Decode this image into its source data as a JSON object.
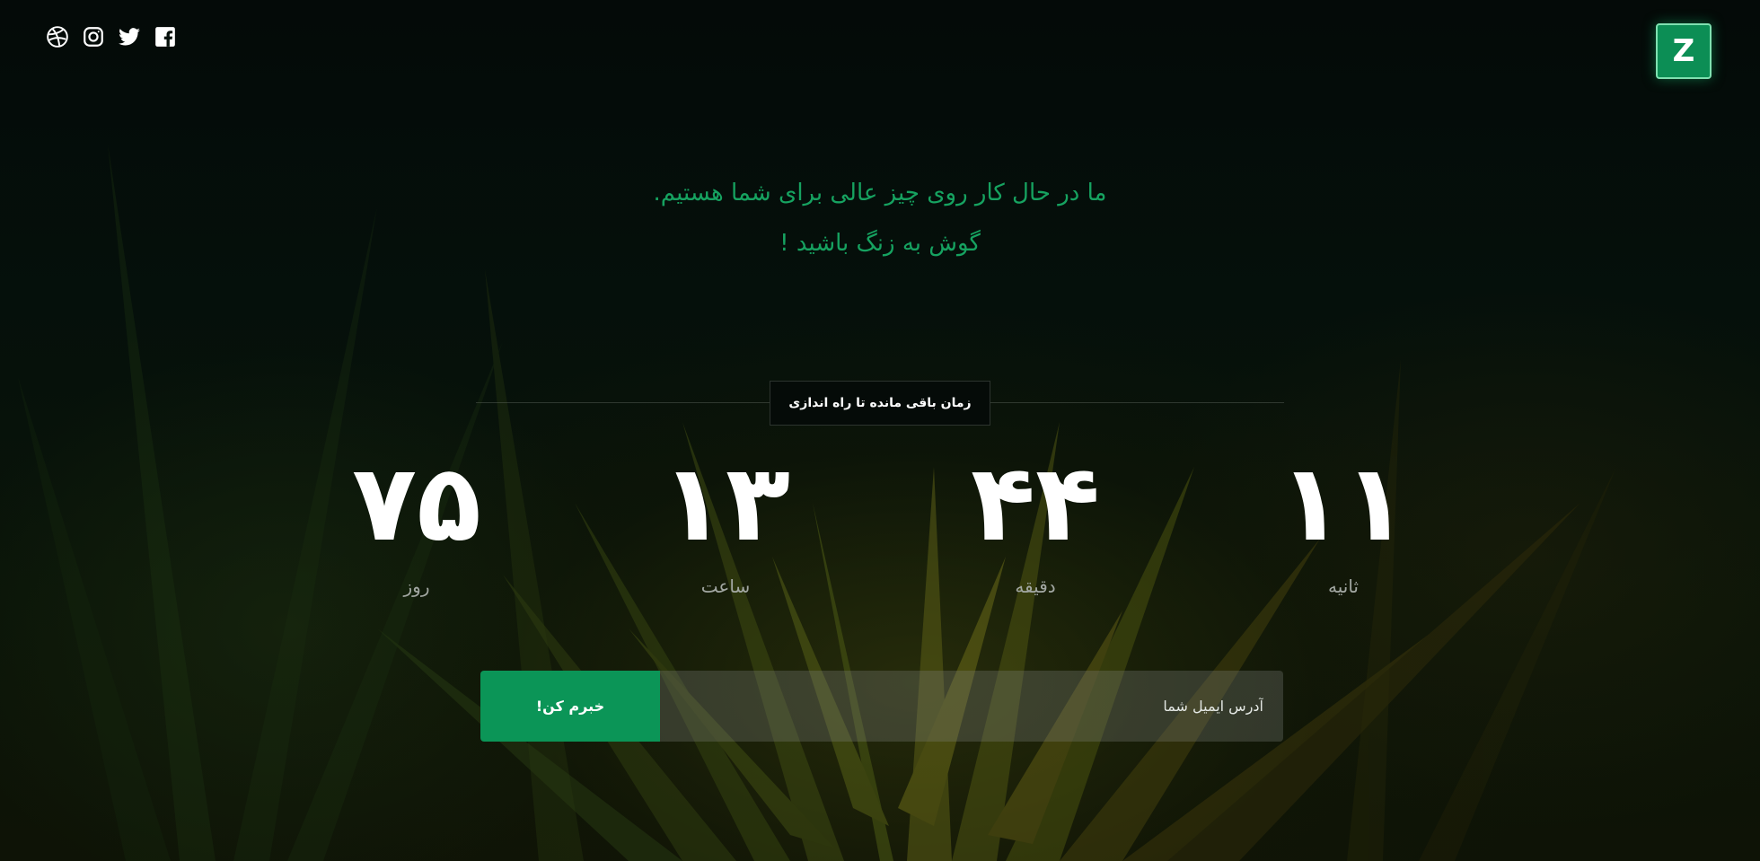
{
  "social": {
    "icons": [
      "dribbble-icon",
      "instagram-icon",
      "twitter-icon",
      "facebook-icon"
    ]
  },
  "logo": {
    "letter": "Z",
    "color": "#0c8e55"
  },
  "headline": {
    "line1": "ما در حال کار روی چیز عالی برای شما هستیم.",
    "line2": "گوش به زنگ باشید !",
    "color": "#16a260"
  },
  "countdown": {
    "caption": "زمان باقی مانده تا راه اندازی",
    "days": {
      "value": "۷۵",
      "label": "روز"
    },
    "hours": {
      "value": "۱۳",
      "label": "ساعت"
    },
    "minutes": {
      "value": "۴۴",
      "label": "دقیقه"
    },
    "seconds": {
      "value": "۱۱",
      "label": "ثانیه"
    }
  },
  "subscribe": {
    "placeholder": "آدرس ایمیل شما",
    "button_label": "خبرم کن!",
    "button_color": "#0b9557"
  }
}
